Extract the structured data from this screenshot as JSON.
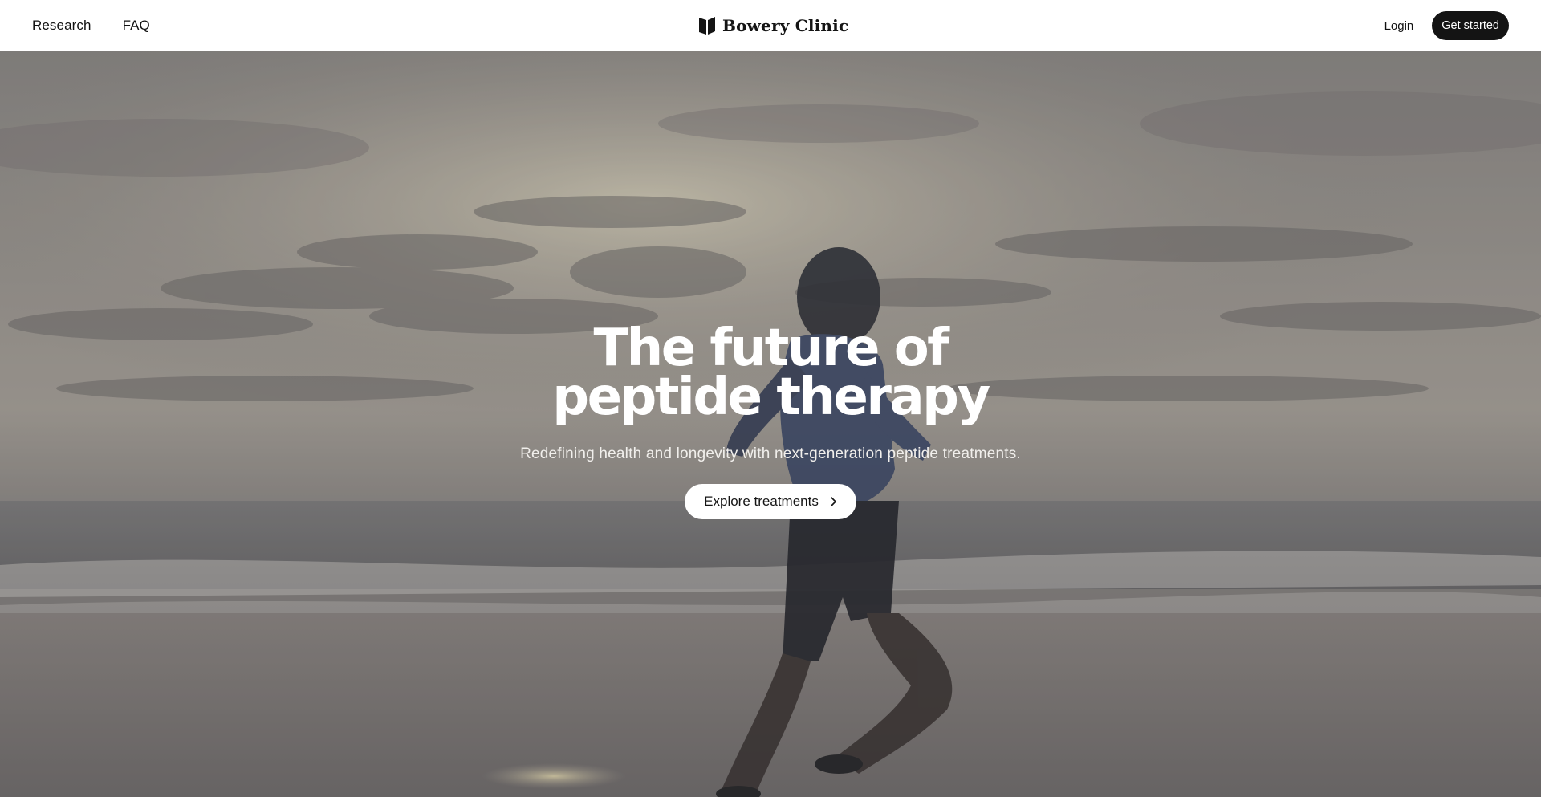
{
  "nav": {
    "links": [
      {
        "label": "Research"
      },
      {
        "label": "FAQ"
      }
    ],
    "brand": "Bowery Clinic",
    "login": "Login",
    "cta": "Get started"
  },
  "hero": {
    "title_line1": "The future of",
    "title_line2": "peptide therapy",
    "subtitle": "Redefining health and longevity with next-generation peptide treatments.",
    "cta": "Explore treatments",
    "cta_icon": "chevron-right-icon",
    "background": "photo of a man in a hoodie running along a beach at dusk"
  },
  "colors": {
    "cta_dark": "#141414",
    "cta_light": "#ffffff",
    "text_dark": "#111111"
  }
}
